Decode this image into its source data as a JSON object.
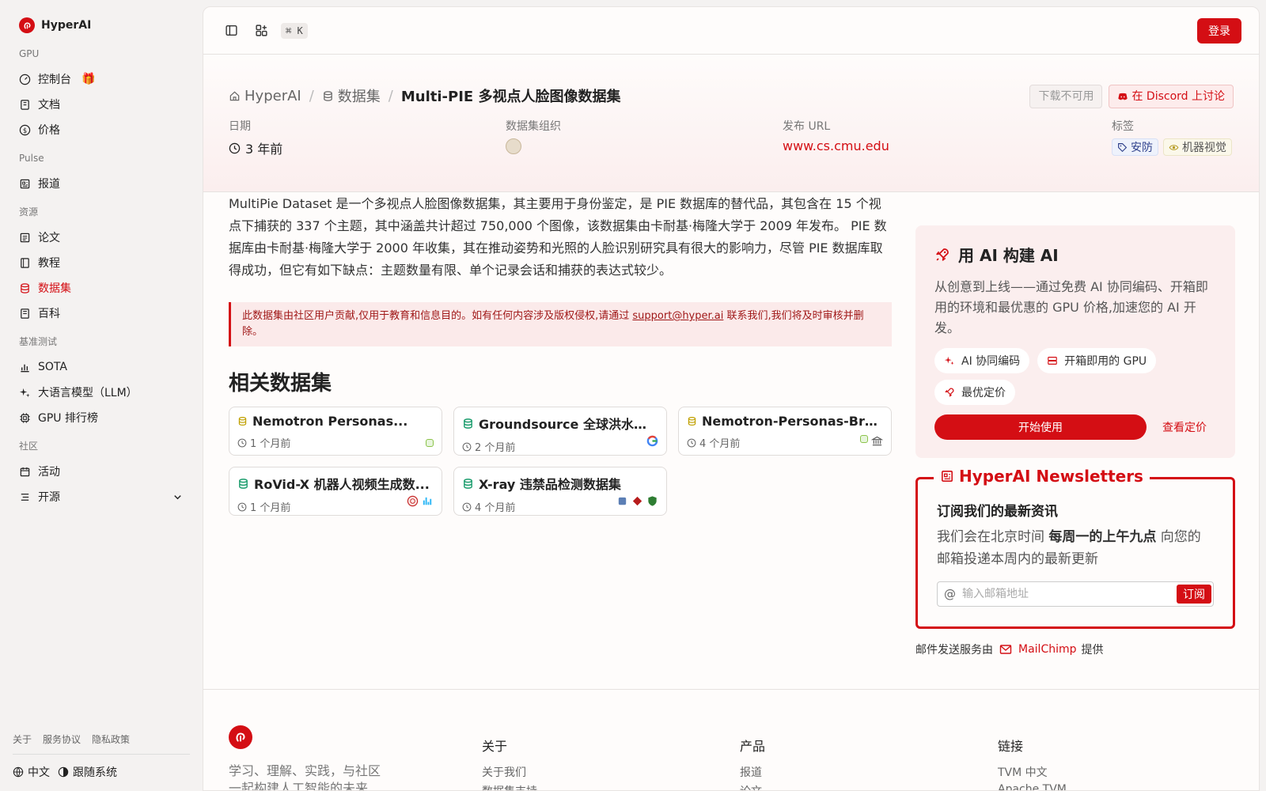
{
  "app": {
    "name": "HyperAI"
  },
  "sidebar": {
    "sections": [
      {
        "label": "GPU",
        "items": [
          {
            "label": "控制台",
            "icon": "dashboard-icon",
            "badge_icon": "gift-icon"
          },
          {
            "label": "文档",
            "icon": "book-icon"
          },
          {
            "label": "价格",
            "icon": "dollar-icon"
          }
        ]
      },
      {
        "label": "Pulse",
        "items": [
          {
            "label": "报道",
            "icon": "newspaper-icon"
          }
        ]
      },
      {
        "label": "资源",
        "items": [
          {
            "label": "论文",
            "icon": "paper-icon"
          },
          {
            "label": "教程",
            "icon": "tutorial-icon"
          },
          {
            "label": "数据集",
            "icon": "database-icon",
            "active": true
          },
          {
            "label": "百科",
            "icon": "wiki-icon"
          }
        ]
      },
      {
        "label": "基准测试",
        "items": [
          {
            "label": "SOTA",
            "icon": "chart-icon"
          },
          {
            "label": "大语言模型（LLM）",
            "icon": "sparkle-icon"
          },
          {
            "label": "GPU 排行榜",
            "icon": "cpu-icon"
          }
        ]
      },
      {
        "label": "社区",
        "items": [
          {
            "label": "活动",
            "icon": "calendar-icon"
          },
          {
            "label": "开源",
            "icon": "list-icon",
            "expandable": true
          }
        ]
      }
    ],
    "footer_links": [
      "关于",
      "服务协议",
      "隐私政策"
    ],
    "language": "中文",
    "theme": "跟随系统"
  },
  "topbar": {
    "shortcut": "⌘ K",
    "login_label": "登录"
  },
  "breadcrumb": {
    "home": "HyperAI",
    "section": "数据集",
    "current": "Multi-PIE 多视点人脸图像数据集"
  },
  "header_actions": {
    "download": "下载不可用",
    "discord": "在 Discord 上讨论"
  },
  "meta": {
    "date_label": "日期",
    "date_value": "3 年前",
    "org_label": "数据集组织",
    "url_label": "发布 URL",
    "url_value": "www.cs.cmu.edu",
    "tags_label": "标签",
    "tags": [
      "安防",
      "机器视觉"
    ]
  },
  "description": "MultiPie Dataset 是一个多视点人脸图像数据集，其主要用于身份鉴定，是 PIE 数据库的替代品，其包含在 15 个视点下捕获的 337 个主题，其中涵盖共计超过 750,000 个图像，该数据集由卡耐基·梅隆大学于 2009 年发布。 PIE 数据库由卡耐基·梅隆大学于 2000 年收集，其在推动姿势和光照的人脸识别研究具有很大的影响力，尽管 PIE 数据库取得成功，但它有如下缺点：主题数量有限、单个记录会话和捕获的表达式较少。",
  "notice": {
    "before": "此数据集由社区用户贡献,仅用于教育和信息目的。如有任何内容涉及版权侵权,请通过 ",
    "email": "support@hyper.ai",
    "after": " 联系我们,我们将及时审核并删除。"
  },
  "related": {
    "title": "相关数据集",
    "cards": [
      {
        "title": "Nemotron Personas...",
        "time": "1 个月前",
        "color": "yellow"
      },
      {
        "title": "Groundsource 全球洪水事...",
        "time": "2 个月前",
        "color": "green"
      },
      {
        "title": "Nemotron-Personas-Bra...",
        "time": "4 个月前",
        "color": "yellow"
      },
      {
        "title": "RoVid-X 机器人视频生成数...",
        "time": "1 个月前",
        "color": "green"
      },
      {
        "title": "X-ray 违禁品检测数据集",
        "time": "4 个月前",
        "color": "green"
      }
    ]
  },
  "promo": {
    "title": "用 AI 构建 AI",
    "text": "从创意到上线——通过免费 AI 协同编码、开箱即用的环境和最优惠的 GPU 价格,加速您的 AI 开发。",
    "chips": [
      "AI 协同编码",
      "开箱即用的 GPU",
      "最优定价"
    ],
    "start": "开始使用",
    "pricing": "查看定价"
  },
  "newsletter": {
    "legend": "HyperAI Newsletters",
    "title": "订阅我们的最新资讯",
    "text_before": "我们会在北京时间 ",
    "text_bold": "每周一的上午九点",
    "text_after": " 向您的邮箱投递本周内的最新更新",
    "placeholder": "输入邮箱地址",
    "subscribe": "订阅",
    "powered_before": "邮件发送服务由",
    "powered_brand": "MailChimp",
    "powered_after": "提供"
  },
  "footer": {
    "tagline": "学习、理解、实践，与社区一起构建人工智能的未来",
    "columns": [
      {
        "title": "关于",
        "links": [
          "关于我们",
          "数据集支持"
        ]
      },
      {
        "title": "产品",
        "links": [
          "报道",
          "论文"
        ]
      },
      {
        "title": "链接",
        "links": [
          "TVM 中文",
          "Apache TVM"
        ]
      }
    ]
  }
}
